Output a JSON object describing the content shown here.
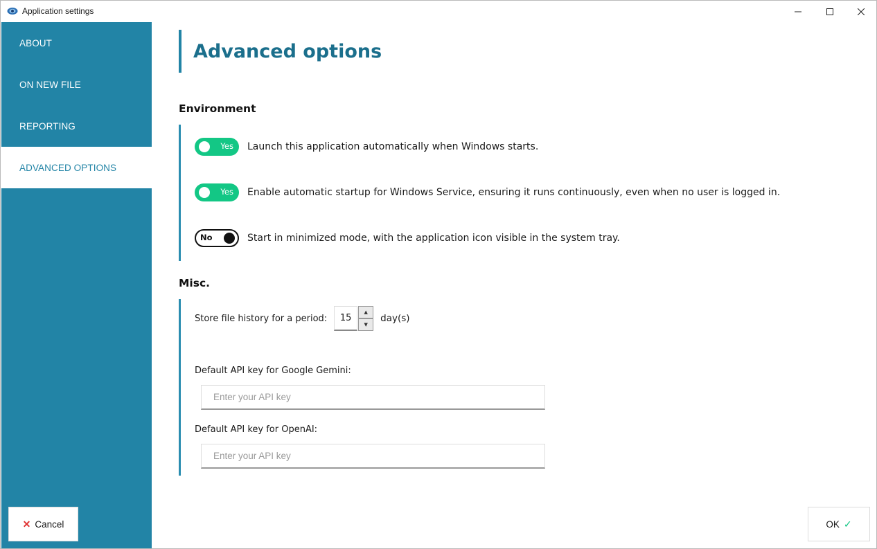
{
  "window": {
    "title": "Application settings",
    "icons": {
      "app": "app-eye-icon",
      "minimize": "minimize-icon",
      "maximize": "maximize-icon",
      "close": "close-icon"
    }
  },
  "sidebar": {
    "items": [
      {
        "label": "ABOUT",
        "active": false
      },
      {
        "label": "ON NEW FILE",
        "active": false
      },
      {
        "label": "REPORTING",
        "active": false
      },
      {
        "label": "ADVANCED OPTIONS",
        "active": true
      }
    ],
    "cancel": {
      "icon": "x-icon",
      "symbol": "✕",
      "label": "Cancel"
    }
  },
  "main": {
    "title": "Advanced options",
    "environment": {
      "heading": "Environment",
      "toggles": [
        {
          "state": "Yes",
          "on": true,
          "text": "Launch this application automatically when Windows starts."
        },
        {
          "state": "Yes",
          "on": true,
          "text": "Enable automatic startup for Windows Service, ensuring it runs continuously, even when no user is logged in."
        },
        {
          "state": "No",
          "on": false,
          "text": "Start in minimized mode, with the application icon visible in the system tray."
        }
      ]
    },
    "misc": {
      "heading": "Misc.",
      "history_label": "Store file history for a period:",
      "history_value": "15",
      "history_unit": "day(s)",
      "gemini_label": "Default API key for Google Gemini:",
      "gemini_placeholder": "Enter your API key",
      "gemini_value": "",
      "openai_label": "Default API key for OpenAI:",
      "openai_placeholder": "Enter your API key",
      "openai_value": ""
    }
  },
  "footer": {
    "ok": {
      "label": "OK",
      "icon": "check-icon",
      "symbol": "✓"
    }
  },
  "colors": {
    "sidebar": "#2284a6",
    "title": "#1b6f8c",
    "toggle_on": "#13c785",
    "cancel_icon": "#e03131"
  }
}
